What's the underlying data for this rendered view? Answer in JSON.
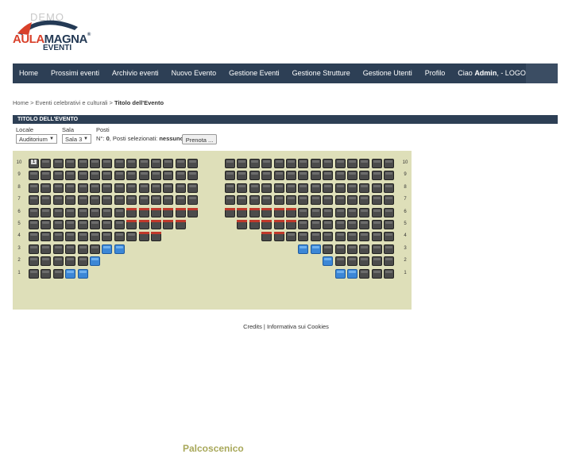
{
  "logo": {
    "demo": "DEMO",
    "aula": "AULA",
    "magna": "MAGNA",
    "registered": "®",
    "eventi": "EVENTI"
  },
  "nav": {
    "items": [
      "Home",
      "Prossimi eventi",
      "Archivio eventi",
      "Nuovo Evento",
      "Gestione Eventi",
      "Gestione Strutture",
      "Gestione Utenti",
      "Profilo"
    ],
    "greeting": "Ciao",
    "user": "Admin",
    "logout": ",  - LOGOUT"
  },
  "breadcrumb": {
    "home": "Home",
    "sep1": " > ",
    "category": "Eventi celebrativi e culturali",
    "sep2": " > ",
    "current": "Titolo dell'Evento"
  },
  "section": {
    "title": "TITOLO DELL'EVENTO"
  },
  "form": {
    "locale_label": "Locale",
    "locale_value": "Auditorium",
    "sala_label": "Sala",
    "sala_value": "Sala 3",
    "posti_label": "Posti",
    "posti_prefix": "N°:",
    "posti_count": "0",
    "posti_mid": ", Posti selezionati:",
    "posti_selected": "nessuno",
    "prenota_label": "Prenota ..."
  },
  "hall": {
    "rows": [
      "10",
      "9",
      "8",
      "7",
      "6",
      "5",
      "4",
      "3",
      "2",
      "1"
    ],
    "stage_label": "Palcoscenico",
    "first_seat_number": "1",
    "left_block": [
      "FFFFFFFFFFFFFF",
      "FFFFFFFFFFFFFF",
      "FFFFFFFFFFFFFF",
      "FFFFFFFFFFFFFF",
      "FFFFFFFFBBBBBB",
      "FFFFFFFFBBBBB.",
      "FFFFFFFFFBB...",
      "FFFFFFRR......",
      "FFFFFR........",
      "FFFRR........."
    ],
    "right_block": [
      "FFFFFFFFFFFFFF",
      "FFFFFFFFFFFFFF",
      "FFFFFFFFFFFFFF",
      "FFFFFFFFFFFFFF",
      "BBBBBBFFFFFFFF",
      ".BBBBBFFFFFFFF",
      "...BBFFFFFFFFF",
      "......RRFFFFFF",
      "........RFFFFF",
      ".........RRFFF"
    ],
    "colors": {
      "background": "#dedfb9",
      "free": "#4b4b4b",
      "booked": "#c0392b",
      "reserved": "#3c87d6"
    }
  },
  "footer": {
    "credits": "Credits",
    "sep": " | ",
    "cookies": "Informativa sui Cookies"
  },
  "colors": {
    "navbar": "#2d3f55",
    "brand_red": "#d9402a",
    "brand_blue": "#243a55"
  }
}
